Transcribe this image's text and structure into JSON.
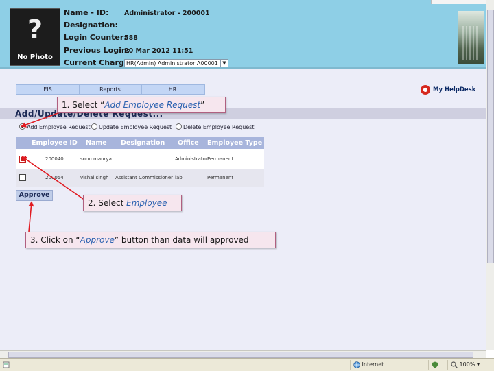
{
  "header": {
    "photo_placeholder": {
      "symbol": "?",
      "label": "No Photo"
    },
    "fields": [
      {
        "label": "Name - ID:",
        "value": "Administrator - 200001"
      },
      {
        "label": "Designation:",
        "value": ""
      },
      {
        "label": "Login Counter:",
        "value": "588"
      },
      {
        "label": "Previous Login:",
        "value": "20 Mar 2012 11:51"
      },
      {
        "label": "Current Charge",
        "value": ""
      }
    ],
    "charge_select": "HR(Admin) Administrator A00001"
  },
  "nav": {
    "tabs": [
      "EIS",
      "Reports",
      "HR"
    ]
  },
  "helpdesk": {
    "icon": "helpdesk-logo-icon",
    "label": "My HelpDesk"
  },
  "page": {
    "heading": "Add/Update/Delete Request...",
    "options": [
      {
        "label": "Add Employee Request",
        "selected": true
      },
      {
        "label": "Update Employee Request",
        "selected": false
      },
      {
        "label": "Delete Employee Request",
        "selected": false
      }
    ]
  },
  "table": {
    "columns": [
      "Employee ID",
      "Name",
      "Designation",
      "Office",
      "Employee Type"
    ],
    "rows": [
      {
        "checked": true,
        "cells": [
          "200040",
          "sonu maurya",
          "",
          "Administrator",
          "Permanent"
        ]
      },
      {
        "checked": false,
        "cells": [
          "200054",
          "vishal singh",
          "Assistant Commissioner",
          "lab",
          "Permanent"
        ]
      }
    ]
  },
  "approve_label": "Approve",
  "callouts": [
    {
      "prefix": "1. Select “",
      "highlight": "Add Employee Request",
      "suffix": "”"
    },
    {
      "prefix": "2. Select ",
      "highlight": "Employee",
      "suffix": ""
    },
    {
      "prefix": "3. Click on “",
      "highlight": "Approve",
      "suffix": "” button than data will approved"
    }
  ],
  "statusbar": {
    "zone": "Internet",
    "zoom": "100%"
  },
  "colors": {
    "header_bg": "#8ecfe6",
    "annotation_arrow": "#e11b22",
    "callout_bg": "#f6e6ee",
    "table_header": "#a8b5dc"
  }
}
